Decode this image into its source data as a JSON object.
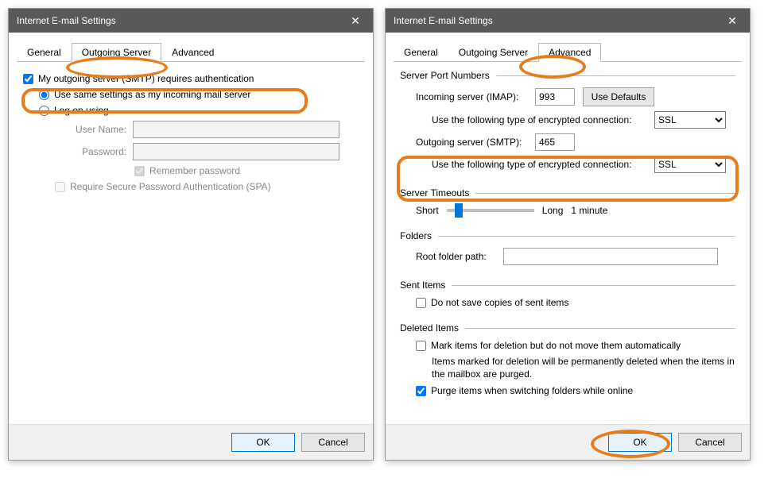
{
  "window_title": "Internet E-mail Settings",
  "tabs": {
    "general": "General",
    "outgoing": "Outgoing Server",
    "advanced": "Advanced"
  },
  "left": {
    "auth_label": "My outgoing server (SMTP) requires authentication",
    "same_settings": "Use same settings as my incoming mail server",
    "log_on_using": "Log on using",
    "user_name_label": "User Name:",
    "user_name_value": "",
    "password_label": "Password:",
    "password_value": "",
    "remember_password": "Remember password",
    "require_spa": "Require Secure Password Authentication (SPA)"
  },
  "right": {
    "server_ports_legend": "Server Port Numbers",
    "incoming_label": "Incoming server (IMAP):",
    "incoming_value": "993",
    "use_defaults": "Use Defaults",
    "encrypted_label": "Use the following type of encrypted connection:",
    "incoming_ssl": "SSL",
    "outgoing_label": "Outgoing server (SMTP):",
    "outgoing_value": "465",
    "outgoing_ssl": "SSL",
    "timeouts_legend": "Server Timeouts",
    "short": "Short",
    "long": "Long",
    "timeout_value": "1 minute",
    "folders_legend": "Folders",
    "root_folder_label": "Root folder path:",
    "root_folder_value": "",
    "sent_legend": "Sent Items",
    "no_save_copies": "Do not save copies of sent items",
    "deleted_legend": "Deleted Items",
    "mark_for_deletion": "Mark items for deletion but do not move them automatically",
    "deletion_note": "Items marked for deletion will be permanently deleted when the items in the mailbox are purged.",
    "purge_items": "Purge items when switching folders while online"
  },
  "buttons": {
    "ok": "OK",
    "cancel": "Cancel"
  }
}
